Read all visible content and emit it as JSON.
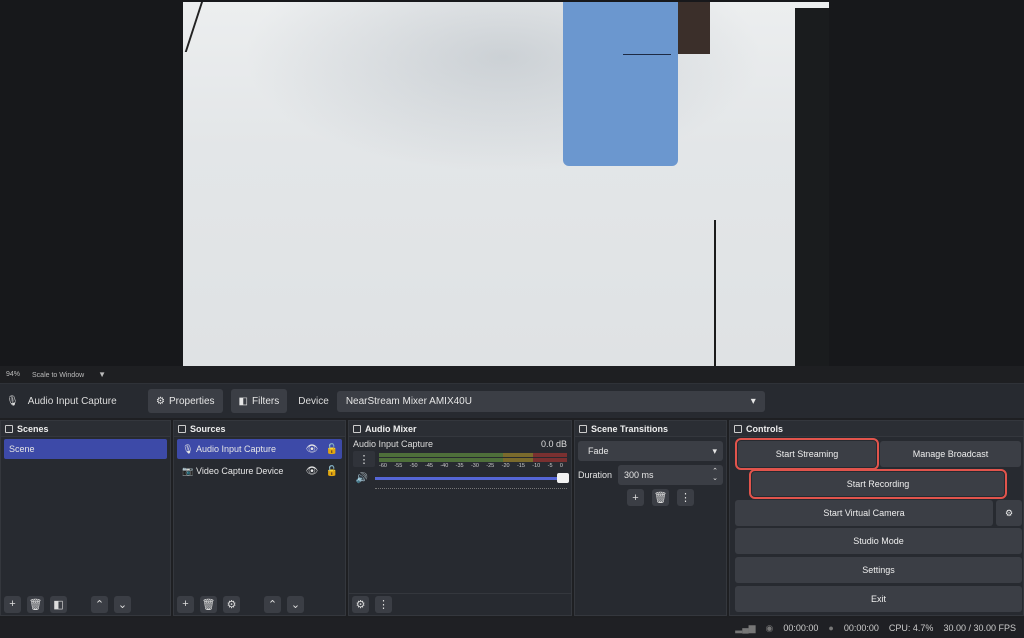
{
  "preview": {
    "zoom": "94%",
    "scale_mode": "Scale to Window"
  },
  "source_toolbar": {
    "source_name": "Audio Input Capture",
    "properties_label": "Properties",
    "filters_label": "Filters",
    "device_label": "Device",
    "device_value": "NearStream Mixer AMIX40U"
  },
  "scenes": {
    "title": "Scenes",
    "items": [
      "Scene"
    ]
  },
  "sources": {
    "title": "Sources",
    "items": [
      {
        "label": "Audio Input Capture",
        "icon": "mic-icon"
      },
      {
        "label": "Video Capture Device",
        "icon": "camera-icon"
      }
    ]
  },
  "audio_mixer": {
    "title": "Audio Mixer",
    "channel_name": "Audio Input Capture",
    "level": "0.0 dB",
    "ticks": [
      "-60",
      "-55",
      "-50",
      "-45",
      "-40",
      "-35",
      "-30",
      "-25",
      "-20",
      "-15",
      "-10",
      "-5",
      "0"
    ],
    "volume_fraction": 1.0
  },
  "transitions": {
    "title": "Scene Transitions",
    "selected": "Fade",
    "duration_label": "Duration",
    "duration_value": "300 ms"
  },
  "controls": {
    "title": "Controls",
    "start_streaming": "Start Streaming",
    "manage_broadcast": "Manage Broadcast",
    "start_recording": "Start Recording",
    "start_virtual_camera": "Start Virtual Camera",
    "studio_mode": "Studio Mode",
    "settings": "Settings",
    "exit": "Exit"
  },
  "status": {
    "stream_time": "00:00:00",
    "record_time": "00:00:00",
    "cpu": "CPU: 4.7%",
    "fps": "30.00 / 30.00 FPS"
  },
  "colors": {
    "accent": "#3d4aa8",
    "highlight": "#e2544c",
    "panel": "#272a30"
  }
}
